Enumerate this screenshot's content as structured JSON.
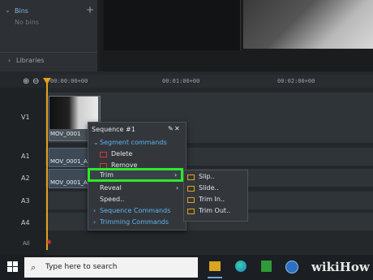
{
  "panel": {
    "bins_label": "Bins",
    "no_bins": "No bins",
    "libraries_label": "Libraries",
    "add": "+"
  },
  "timeline": {
    "timecodes": [
      "00:00:00+00",
      "00:01:00+00",
      "00:02:00+00"
    ],
    "tracks": [
      "V1",
      "A1",
      "A2",
      "A3",
      "A4",
      "All"
    ],
    "clip_label": "MOV_0001",
    "clip_label_a1": "MOV_0001_A",
    "clip_label_a2": "MOV_0001_A"
  },
  "menu": {
    "title": "Sequence #1",
    "segment_commands": "Segment commands",
    "delete": "Delete",
    "remove": "Remove",
    "trim": "Trim",
    "reveal": "Reveal",
    "speed": "Speed..",
    "sequence_commands": "Sequence Commands",
    "trimming_commands": "Trimming Commands"
  },
  "submenu": {
    "slip": "Slip..",
    "slide": "Slide..",
    "trim_in": "Trim In..",
    "trim_out": "Trim Out.."
  },
  "taskbar": {
    "search_placeholder": "Type here to search",
    "watermark": "wikiHow"
  },
  "colors": {
    "accent_blue": "#5fb2f0",
    "highlight_green": "#2ee82e",
    "playhead": "#e3a01b"
  }
}
